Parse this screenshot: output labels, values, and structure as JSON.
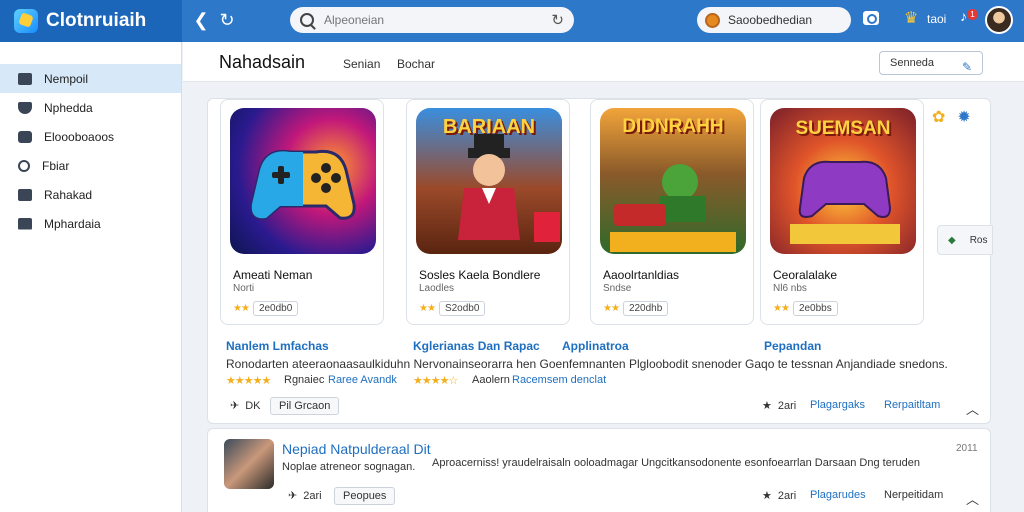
{
  "app": {
    "brand": "Clotnruiaih",
    "brand_icon": "app-logo-icon"
  },
  "topbar": {
    "search_placeholder": "Alpeoneian",
    "account_label": "Saoobedhedian",
    "user_label": "taoi",
    "notif_count": "1"
  },
  "sidebar": {
    "items": [
      {
        "label": "Nempoil",
        "icon": "home-icon",
        "active": true
      },
      {
        "label": "Nphedda",
        "icon": "shield-icon"
      },
      {
        "label": "Eloooboaoos",
        "icon": "chat-icon"
      },
      {
        "label": "Fbiar",
        "icon": "clock-icon"
      },
      {
        "label": "Rahakad",
        "icon": "settings-icon"
      },
      {
        "label": "Mphardaia",
        "icon": "mail-icon"
      }
    ]
  },
  "header": {
    "title": "Nahadsain",
    "tabs": [
      "Senian",
      "Bochar"
    ],
    "button_label": "Senneda"
  },
  "games": [
    {
      "thumb_text": "",
      "title": "Ameati Neman",
      "sub": "Norti",
      "meta": "2e0db0",
      "thumb_colors": [
        "#1b2f8f",
        "#8a2be2",
        "#ff7a1a"
      ]
    },
    {
      "thumb_text": "BARIAAN",
      "title": "Sosles Kaela Bondlere",
      "sub": "Laodles",
      "meta": "S2odb0",
      "thumb_colors": [
        "#3a8ede",
        "#c2452a",
        "#6b2a14"
      ]
    },
    {
      "thumb_text": "DIDNRAHH",
      "title": "Aaoolrtanldias",
      "sub": "Sndse",
      "meta": "220dhb",
      "thumb_colors": [
        "#f3b53a",
        "#2f8a3a",
        "#7a3a12"
      ]
    },
    {
      "thumb_text": "SUEMSAN",
      "title": "Ceoralalake",
      "sub": "Nl6 nbs",
      "meta": "2e0bbs",
      "thumb_colors": [
        "#e0542a",
        "#8f3ac2",
        "#ffcf3a"
      ]
    }
  ],
  "side_tools": {
    "badge_icon": "award-icon",
    "gear_icon": "gear-icon",
    "mini_label": "Ros"
  },
  "descriptions": {
    "headings": [
      "Nanlem Lmfachas",
      "Kglerianas Dan Rapac",
      "Applinatroa",
      "Pepandan"
    ],
    "text": "Ronodarten ateeraonaasaulkiduhn   Nervonainseorarra hen Goenfemnanten Plgloobodit snenoder Gaqo te tessnan Anjandiade snedons.",
    "ratings": [
      {
        "stars": "★★★★★",
        "label": "Rgnaiec",
        "label2": "Raree Avandk"
      },
      {
        "stars": "★★★★☆",
        "label": "Aaolern",
        "label2": "Racemsem denclat"
      }
    ]
  },
  "panel_footer": {
    "share": "DK",
    "pill": "Pil Grcaon",
    "likes": "2ari",
    "link1": "Plagargaks",
    "link2": "Rerpaitltam"
  },
  "second": {
    "title": "Nepiad Natpulderaal Dit",
    "year": "2011",
    "sub": "Noplae atreneor sognagan.",
    "desc": "Aproacerniss! yraudelraisaln ooloadmagar Ungcitkansodonente esonfoearrlan Darsaan Dng teruden",
    "count": "2ari",
    "pill": "Peopues",
    "likes": "2ari",
    "link1": "Plagarudes",
    "link2": "Nerpeitidam"
  }
}
